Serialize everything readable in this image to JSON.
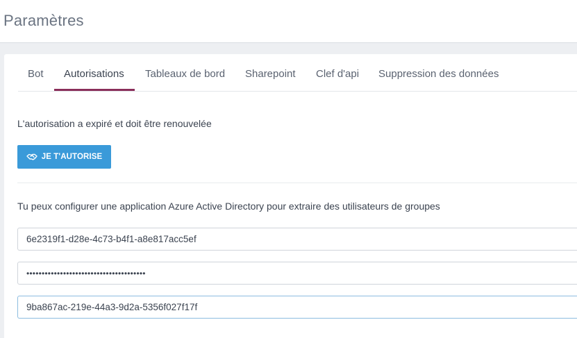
{
  "page": {
    "title": "Paramètres"
  },
  "tabs": [
    {
      "label": "Bot",
      "active": false
    },
    {
      "label": "Autorisations",
      "active": true
    },
    {
      "label": "Tableaux de bord",
      "active": false
    },
    {
      "label": "Sharepoint",
      "active": false
    },
    {
      "label": "Clef d'api",
      "active": false
    },
    {
      "label": "Suppression des données",
      "active": false
    }
  ],
  "authorization": {
    "message": "L'autorisation a expiré et doit être renouvelée",
    "button_label": "JE T'AUTORISE",
    "button_icon": "handshake-icon"
  },
  "azure": {
    "info": "Tu peux configurer une application Azure Active Directory pour extraire des utilisateurs de groupes",
    "client_id": "6e2319f1-d28e-4c73-b4f1-a8e817acc5ef",
    "client_secret_masked": "•••••••••••••••••••••••••••••••••••••••",
    "tenant_id": "9ba867ac-219e-44a3-9d2a-5356f027f17f"
  },
  "colors": {
    "accent_tab": "#8a2e5a",
    "button": "#3a9ad9",
    "focused_border": "#8cbce0"
  }
}
